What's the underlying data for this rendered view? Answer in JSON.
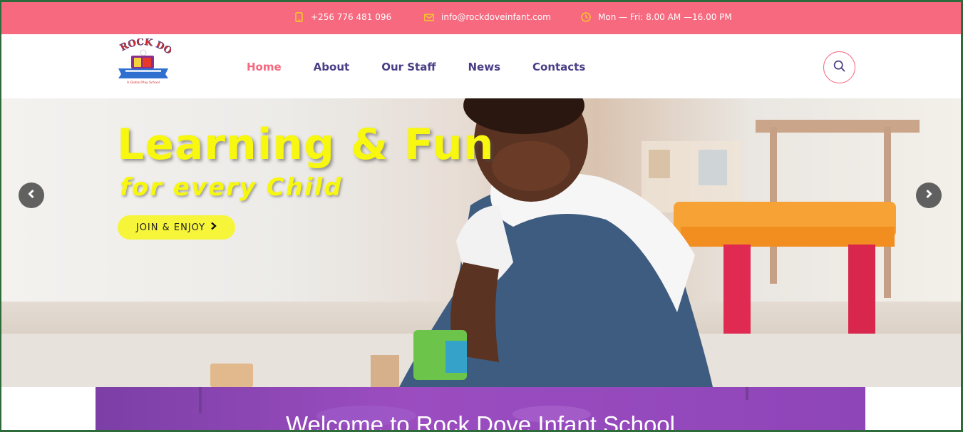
{
  "topbar": {
    "phone": "+256 776 481 096",
    "email": "info@rockdoveinfant.com",
    "hours": "Mon — Fri: 8.00 AM —16.00 PM",
    "icon_color": "#f7c52b",
    "background": "#f6697f"
  },
  "logo": {
    "text": "ROCK DOVE",
    "tagline": "A Global Play School"
  },
  "nav": {
    "items": [
      {
        "label": "Home",
        "active": true
      },
      {
        "label": "About",
        "active": false
      },
      {
        "label": "Our Staff",
        "active": false
      },
      {
        "label": "News",
        "active": false
      },
      {
        "label": "Contacts",
        "active": false
      }
    ],
    "active_color": "#f6697f",
    "color": "#4a3f86"
  },
  "search": {
    "icon": "search-icon"
  },
  "hero": {
    "title": "Learning & Fun",
    "subtitle": "for every Child",
    "cta_label": "JOIN & ENJOY",
    "title_color": "#f7f70f",
    "prev_icon": "chevron-left-icon",
    "next_icon": "chevron-right-icon"
  },
  "welcome": {
    "title": "Welcome to Rock Dove Infant School",
    "background": "#8e45b8"
  }
}
